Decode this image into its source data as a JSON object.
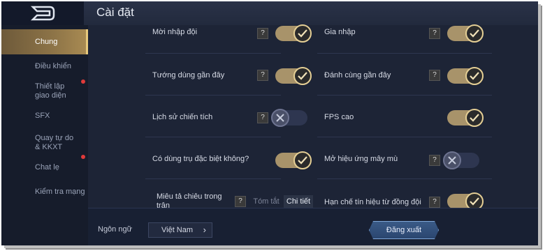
{
  "header": {
    "title": "Cài đặt"
  },
  "sidebar": {
    "items": [
      {
        "label": "Chung",
        "active": true,
        "dot": false
      },
      {
        "label": "Điều khiển",
        "active": false,
        "dot": false
      },
      {
        "label": "Thiết lập giao diện",
        "active": false,
        "dot": true
      },
      {
        "label": "SFX",
        "active": false,
        "dot": false
      },
      {
        "label": "Quay tự do & KKXT",
        "active": false,
        "dot": false
      },
      {
        "label": "Chat lẹ",
        "active": false,
        "dot": true
      },
      {
        "label": "Kiểm tra mạng",
        "active": false,
        "dot": false
      }
    ]
  },
  "settings": {
    "moi_nhap_doi": {
      "label": "Mời nhập đội",
      "help": "?",
      "on": true
    },
    "gia_nhap": {
      "label": "Gia nhập",
      "help": "?",
      "on": true
    },
    "tuong_dung": {
      "label": "Tướng dùng gần đây",
      "help": "?",
      "on": true
    },
    "danh_cung": {
      "label": "Đánh cùng gần đây",
      "help": "?",
      "on": true
    },
    "lich_su": {
      "label": "Lịch sử chiến tích",
      "help": "?",
      "on": false
    },
    "fps_cao": {
      "label": "FPS cao",
      "on": true
    },
    "tru_dac_biet": {
      "label": "Có dùng trụ đặc biệt không?",
      "on": true
    },
    "may_mu": {
      "label": "Mở hiệu ứng mây mù",
      "help": "?",
      "on": false
    },
    "mieu_ta": {
      "label": "Miêu tả chiêu trong trận",
      "help": "?",
      "options": [
        "Tóm tắt",
        "Chi tiết"
      ],
      "selected": "Chi tiết"
    },
    "han_che": {
      "label": "Hạn chế tín hiệu từ đồng đội",
      "help": "?",
      "on": true
    }
  },
  "footer": {
    "language_label": "Ngôn ngữ",
    "language_value": "Việt Nam",
    "chevron": "›",
    "logout_label": "Đăng xuất"
  },
  "colors": {
    "accent": "#a8936a",
    "knob_ring": "#e5cf95",
    "sidebar_active": "#8c7347"
  }
}
